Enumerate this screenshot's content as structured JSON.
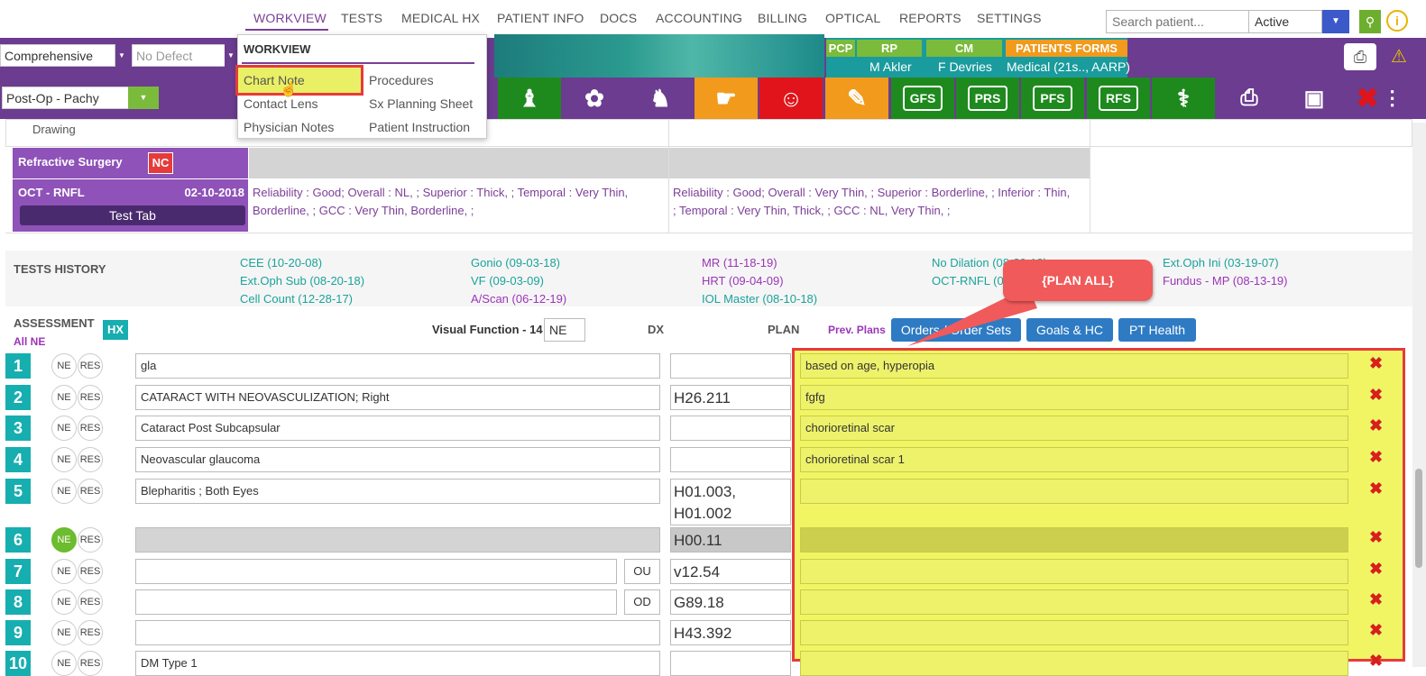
{
  "nav": {
    "items": [
      "WORKVIEW",
      "TESTS",
      "MEDICAL HX",
      "PATIENT INFO",
      "DOCS",
      "ACCOUNTING",
      "BILLING",
      "OPTICAL",
      "REPORTS",
      "SETTINGS"
    ],
    "search_placeholder": "Search patient...",
    "status": "Active"
  },
  "toolbar": {
    "exam_type": "Comprehensive",
    "defect": "No Defect",
    "template": "Post-Op - Pachy",
    "tags": {
      "pcp": "PCP",
      "rp": "RP",
      "cm": "CM",
      "forms": "PATIENTS FORMS"
    },
    "rp_value": "M Akler",
    "cm_value": "F Devries",
    "forms_value": "Medical (21s.., AARP)",
    "boxed": [
      "GFS",
      "PRS",
      "PFS",
      "RFS"
    ]
  },
  "menu": {
    "title": "WORKVIEW",
    "items": [
      "Chart Note",
      "Procedures",
      "Contact Lens",
      "Sx Planning Sheet",
      "Physician Notes",
      "Patient Instruction"
    ]
  },
  "chart": {
    "drawing": "Drawing",
    "refractive": "Refractive Surgery",
    "nc": "NC",
    "oct_label": "OCT - RNFL",
    "oct_date": "02-10-2018",
    "test_tab": "Test Tab",
    "od_line1": "Reliability : Good; Overall : NL, ; Superior : Thick, ; Temporal : Very Thin,",
    "od_line2": "Borderline, ; GCC : Very Thin, Borderline, ;",
    "os_line1": "Reliability : Good; Overall : Very Thin, ; Superior : Borderline, ; Inferior : Thin,",
    "os_line2": "; Temporal : Very Thin, Thick, ; GCC : NL, Very Thin, ;"
  },
  "history": {
    "title": "TESTS HISTORY",
    "col1": [
      "CEE (10-20-08)",
      "Ext.Oph Sub (08-20-18)",
      "Cell Count (12-28-17)"
    ],
    "col2": [
      "Gonio (09-03-18)",
      "VF (09-03-09)",
      "A/Scan (06-12-19)"
    ],
    "col3": [
      "MR (11-18-19)",
      "HRT (09-04-09)",
      "IOL Master (08-10-18)"
    ],
    "col4": [
      "No Dilation (08-20-18)",
      "OCT-RNFL (0"
    ],
    "col5": [
      "Ext.Oph Ini (03-19-07)",
      "Fundus - MP (08-13-19)"
    ]
  },
  "assessment": {
    "title": "ASSESSMENT",
    "hx": "HX",
    "all_ne": "All NE",
    "visual_function": "Visual Function - 14",
    "vf_value": "NE",
    "dx": "DX",
    "plan": "PLAN",
    "prev_plans": "Prev. Plans",
    "orders_btn": "Orders / Order Sets",
    "goals_btn": "Goals & HC",
    "pt_health_btn": "PT Health",
    "callout": "{PLAN ALL}",
    "ne": "NE",
    "res": "RES",
    "rows": [
      {
        "num": "1",
        "assessment": "gla",
        "dx": "",
        "plan": "based on age, hyperopia",
        "eye": ""
      },
      {
        "num": "2",
        "assessment": "CATARACT WITH NEOVASCULIZATION; Right",
        "dx": "H26.211",
        "plan": "fgfg",
        "eye": ""
      },
      {
        "num": "3",
        "assessment": "Cataract Post Subcapsular",
        "dx": "",
        "plan": "chorioretinal scar",
        "eye": ""
      },
      {
        "num": "4",
        "assessment": "Neovascular glaucoma",
        "dx": "",
        "plan": "chorioretinal scar 1",
        "eye": ""
      },
      {
        "num": "5",
        "assessment": "Blepharitis ; Both Eyes",
        "dx": "H01.003, H01.002",
        "plan": "",
        "eye": ""
      },
      {
        "num": "6",
        "assessment": "",
        "dx": "H00.11",
        "plan": "",
        "eye": ""
      },
      {
        "num": "7",
        "assessment": "",
        "dx": "v12.54",
        "plan": "",
        "eye": "OU"
      },
      {
        "num": "8",
        "assessment": "",
        "dx": "G89.18",
        "plan": "",
        "eye": "OD"
      },
      {
        "num": "9",
        "assessment": "",
        "dx": "H43.392",
        "plan": "",
        "eye": ""
      },
      {
        "num": "10",
        "assessment": "DM Type 1",
        "dx": "",
        "plan": "",
        "eye": ""
      }
    ]
  },
  "colors": {
    "purple": "#6b3c8f",
    "teal": "#17aeb0",
    "green": "#1e8a1e",
    "highlight": "#eef26b",
    "red": "#e63b3b"
  }
}
